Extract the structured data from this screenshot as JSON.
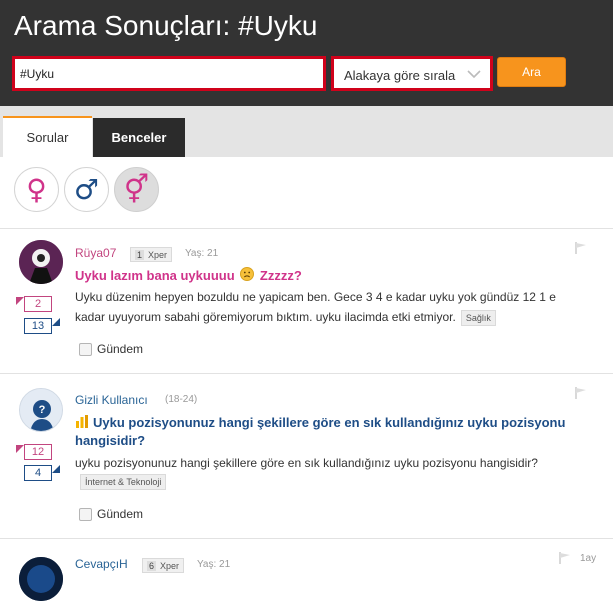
{
  "page_title": "Arama Sonuçları: #Uyku",
  "search": {
    "value": "#Uyku",
    "sort_label": "Alakaya göre sırala",
    "button_label": "Ara"
  },
  "tabs": [
    {
      "label": "Sorular"
    },
    {
      "label": "Benceler"
    }
  ],
  "gender_filters": [
    {
      "icon": "female-icon",
      "symbol": "♀",
      "color": "#d0338a"
    },
    {
      "icon": "male-icon",
      "symbol": "♂",
      "color": "#1e4d86"
    },
    {
      "icon": "unisex-icon",
      "symbol": "⚥",
      "color": "#d0338a"
    }
  ],
  "questions": [
    {
      "user": "Rüya07",
      "level": "1",
      "badge": "Xper",
      "age": "Yaş: 21",
      "title": "Uyku lazım bana uykuuuu",
      "title_suffix": "Zzzzz?",
      "body": "Uyku düzenim hepyen bozuldu ne yapicam ben. Gece 3 4 e kadar uyku yok gündüz 12 1 e kadar uyuyorum sabahi göremiyorum bıktım. uyku ilacimda etki etmiyor.",
      "tag": "Sağlık",
      "votes_up": "2",
      "votes_down": "13",
      "gundem_label": "Gündem"
    },
    {
      "user": "Gizli Kullanıcı",
      "age": "(18-24)",
      "title": "Uyku pozisyonunuz hangi şekillere göre en sık kullandığınız uyku pozisyonu hangisidir?",
      "body": "uyku pozisyonunuz hangi şekillere göre en sık kullandığınız uyku pozisyonu hangisidir?",
      "tag": "İnternet & Teknoloji",
      "votes_up": "12",
      "votes_down": "4",
      "gundem_label": "Gündem"
    },
    {
      "user": "CevapçıH",
      "level": "6",
      "badge": "Xper",
      "age": "Yaş: 21",
      "time": "1ay"
    }
  ]
}
